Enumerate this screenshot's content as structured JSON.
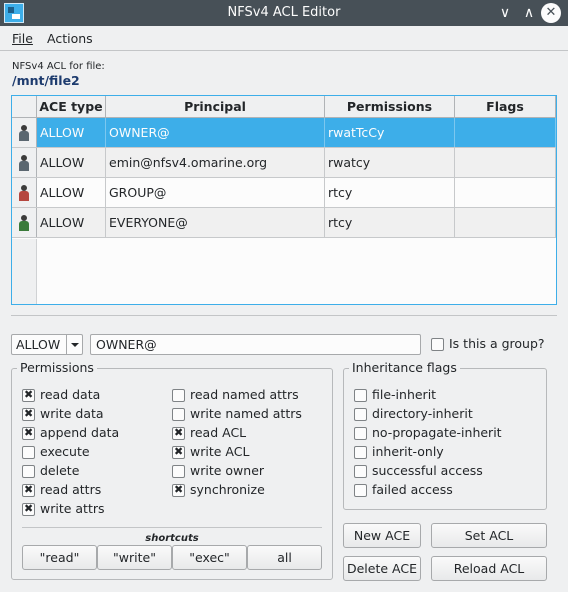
{
  "window": {
    "title": "NFSv4 ACL Editor",
    "icons": [
      "app-icon",
      "minimize-icon",
      "maximize-icon",
      "close-icon"
    ]
  },
  "menu": {
    "file": "File",
    "actions": "Actions"
  },
  "file_caption": "NFSv4 ACL for file:",
  "file_path": "/mnt/file2",
  "table": {
    "headers": [
      "ACE type",
      "Principal",
      "Permissions",
      "Flags"
    ],
    "rows": [
      {
        "icon": "owner-icon",
        "type": "ALLOW",
        "principal": "OWNER@",
        "permissions": "rwatTcCy",
        "flags": ""
      },
      {
        "icon": "user-icon",
        "type": "ALLOW",
        "principal": "emin@nfsv4.omarine.org",
        "permissions": "rwatcy",
        "flags": ""
      },
      {
        "icon": "group-icon",
        "type": "ALLOW",
        "principal": "GROUP@",
        "permissions": "rtcy",
        "flags": ""
      },
      {
        "icon": "everyone-icon",
        "type": "ALLOW",
        "principal": "EVERYONE@",
        "permissions": "rtcy",
        "flags": ""
      }
    ]
  },
  "editor": {
    "ace_type": "ALLOW",
    "principal_value": "OWNER@",
    "is_group_label": "Is this a group?",
    "is_group": false
  },
  "permissions": {
    "title": "Permissions",
    "left": [
      {
        "label": "read data",
        "checked": true
      },
      {
        "label": "write data",
        "checked": true
      },
      {
        "label": "append data",
        "checked": true
      },
      {
        "label": "execute",
        "checked": false
      },
      {
        "label": "delete",
        "checked": false
      },
      {
        "label": "read attrs",
        "checked": true
      },
      {
        "label": "write attrs",
        "checked": true
      }
    ],
    "right": [
      {
        "label": "read named attrs",
        "checked": false
      },
      {
        "label": "write named attrs",
        "checked": false
      },
      {
        "label": "read ACL",
        "checked": true
      },
      {
        "label": "write ACL",
        "checked": true
      },
      {
        "label": "write owner",
        "checked": false
      },
      {
        "label": "synchronize",
        "checked": true
      }
    ],
    "shortcuts_title": "shortcuts",
    "shortcuts": [
      "\"read\"",
      "\"write\"",
      "\"exec\"",
      "all"
    ]
  },
  "inheritance": {
    "title": "Inheritance flags",
    "flags": [
      {
        "label": "file-inherit",
        "checked": false
      },
      {
        "label": "directory-inherit",
        "checked": false
      },
      {
        "label": "no-propagate-inherit",
        "checked": false
      },
      {
        "label": "inherit-only",
        "checked": false
      },
      {
        "label": "successful access",
        "checked": false
      },
      {
        "label": "failed access",
        "checked": false
      }
    ]
  },
  "actions": {
    "new_ace": "New ACE",
    "set_acl": "Set ACL",
    "delete_ace": "Delete ACE",
    "reload_acl": "Reload ACL"
  },
  "colors": {
    "accent": "#3daee9",
    "titlebar": "#475057",
    "window_bg": "#eff0f1"
  }
}
